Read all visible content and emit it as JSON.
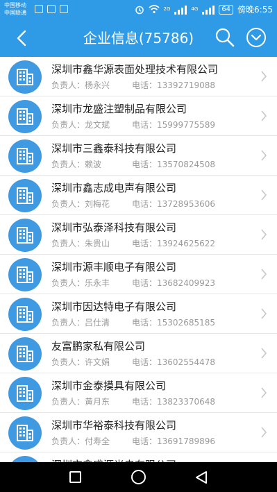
{
  "status": {
    "carrier1": "中国移动",
    "carrier2": "中国联通",
    "net1": "2G",
    "net2": "4G",
    "battery": "64",
    "time": "傍晚6:55"
  },
  "header": {
    "title": "企业信息(75786)"
  },
  "labels": {
    "person": "负责人：",
    "phone": "电话："
  },
  "companies": [
    {
      "name": "深圳市鑫华源表面处理技术有限公司",
      "person": "杨永兴",
      "phone": "13392719088"
    },
    {
      "name": "深圳市龙盛注塑制品有限公司",
      "person": "龙文斌",
      "phone": "15999775589"
    },
    {
      "name": "深圳市三鑫泰科技有限公司",
      "person": "赖波",
      "phone": "13570824508"
    },
    {
      "name": "深圳市鑫志成电声有限公司",
      "person": "刘梅花",
      "phone": "13728953606"
    },
    {
      "name": "深圳市弘泰泽科技有限公司",
      "person": "朱贵山",
      "phone": "13924625622"
    },
    {
      "name": "深圳市源丰顺电子有限公司",
      "person": "乐永丰",
      "phone": "13682409923"
    },
    {
      "name": "深圳市因达特电子有限公司",
      "person": "吕仕清",
      "phone": "15302685185"
    },
    {
      "name": "友富鹏家私有限公司",
      "person": "许文娟",
      "phone": "13602554478"
    },
    {
      "name": "深圳市金泰摸具有限公司",
      "person": "黄月东",
      "phone": "13823370648"
    },
    {
      "name": "深圳市华裕泰科技有限公司",
      "person": "付寿全",
      "phone": "13691789896"
    },
    {
      "name": "深圳市鑫盛源光电有限公司",
      "person": "",
      "phone": ""
    }
  ],
  "colors": {
    "accent": "#2f9ae6",
    "avatar": "#3f9ae2"
  },
  "icons": [
    "back-arrow-icon",
    "search-icon",
    "chevron-down-circle-icon",
    "building-icon",
    "chevron-right-icon",
    "nav-recents-icon",
    "nav-home-icon",
    "nav-back-icon"
  ]
}
